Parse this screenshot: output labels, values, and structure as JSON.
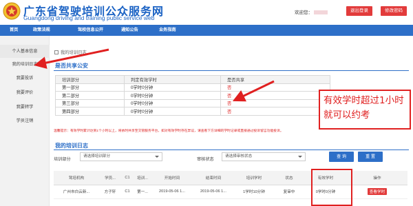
{
  "header": {
    "title_cn": "广东省驾驶培训公众服务网",
    "title_en": "Guangdong driving and training public service web",
    "welcome_label": "欢迎您：",
    "logout_label": "退出登录",
    "change_password_label": "修改密码"
  },
  "nav": {
    "items": [
      "首页",
      "政策法规",
      "驾校信息公开",
      "通知公告",
      "业务指南"
    ]
  },
  "sidebar": {
    "items": [
      "个人基本信息",
      "我的培训日志",
      "我要投诉",
      "我要评价",
      "我要转学",
      "学员注销"
    ]
  },
  "main": {
    "breadcrumb": "我的培训日志",
    "share_title": "是否共享公安",
    "share_table": {
      "headers": [
        "培训部分",
        "判定有效学时",
        "是否共享"
      ],
      "rows": [
        [
          "第一部分",
          "0学时0分钟",
          "否"
        ],
        [
          "第二部分",
          "0学时0分钟",
          "否"
        ],
        [
          "第三部分",
          "0学时0分钟",
          "否"
        ],
        [
          "第四部分",
          "0学时0分钟",
          "否"
        ]
      ]
    },
    "notice": "温馨提示：有效学时累计达到1个小时以上，将依时共享至交管服务平台，如对有效学时存在异议，请查看下方详细的学时记录或直接通过投诉留言功能投诉。",
    "logs_title": "我的培训日志",
    "filters": {
      "part_label": "培训部分",
      "part_placeholder": "请选择培训部分",
      "status_label": "审核状态",
      "status_placeholder": "请选择审核状态",
      "query_label": "查 询",
      "reset_label": "重 置"
    },
    "logs_table": {
      "headers": [
        "驾培机构",
        "学员...",
        "C1",
        "培训...",
        "开始时间",
        "结束时间",
        "培训学时",
        "状态",
        "有效学时",
        "操作"
      ],
      "rows": [
        [
          "广州市白云新...",
          "方子轩",
          "C1",
          "第一...",
          "2019-05-06 1...",
          "2019-05-06 1...",
          "1学时10分钟",
          "复审中",
          "0学时0分钟",
          "查看学时"
        ]
      ]
    }
  },
  "annotation": {
    "callout_text": "有效学时超过1小时就可以约考",
    "color": "#e02020"
  },
  "colors": {
    "brand_blue": "#2d6fc8",
    "accent_red": "#e23b3b"
  }
}
